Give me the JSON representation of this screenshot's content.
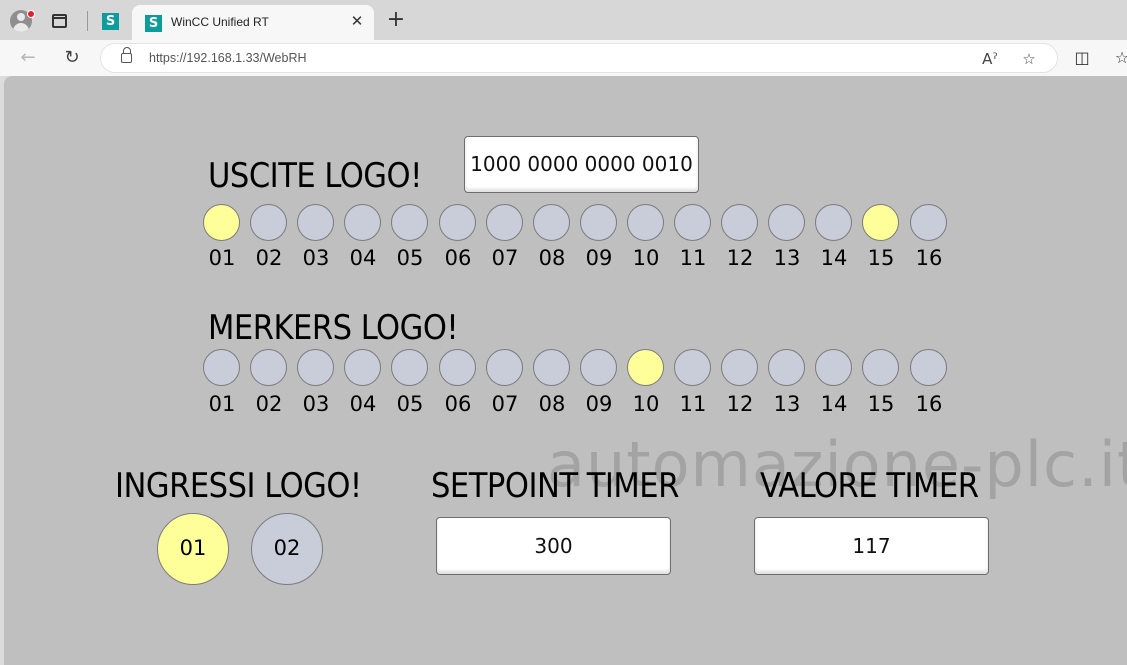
{
  "browser": {
    "tab_title": "WinCC Unified RT",
    "tab_logo": "S",
    "url": "https://192.168.1.33/WebRH",
    "icons": [
      "profile-icon",
      "tab-actions-icon",
      "back-icon",
      "reload-icon",
      "lock-icon",
      "read-aloud-icon",
      "favorite-star-icon",
      "split-screen-icon",
      "favorites-icon",
      "close-icon",
      "new-tab-icon"
    ]
  },
  "hmi": {
    "uscite": {
      "title": "USCITE LOGO!",
      "binary": "1000 0000 0000 0010",
      "leds": [
        {
          "num": "01",
          "on": true
        },
        {
          "num": "02",
          "on": false
        },
        {
          "num": "03",
          "on": false
        },
        {
          "num": "04",
          "on": false
        },
        {
          "num": "05",
          "on": false
        },
        {
          "num": "06",
          "on": false
        },
        {
          "num": "07",
          "on": false
        },
        {
          "num": "08",
          "on": false
        },
        {
          "num": "09",
          "on": false
        },
        {
          "num": "10",
          "on": false
        },
        {
          "num": "11",
          "on": false
        },
        {
          "num": "12",
          "on": false
        },
        {
          "num": "13",
          "on": false
        },
        {
          "num": "14",
          "on": false
        },
        {
          "num": "15",
          "on": true
        },
        {
          "num": "16",
          "on": false
        }
      ]
    },
    "merkers": {
      "title": "MERKERS LOGO!",
      "leds": [
        {
          "num": "01",
          "on": false
        },
        {
          "num": "02",
          "on": false
        },
        {
          "num": "03",
          "on": false
        },
        {
          "num": "04",
          "on": false
        },
        {
          "num": "05",
          "on": false
        },
        {
          "num": "06",
          "on": false
        },
        {
          "num": "07",
          "on": false
        },
        {
          "num": "08",
          "on": false
        },
        {
          "num": "09",
          "on": false
        },
        {
          "num": "10",
          "on": true
        },
        {
          "num": "11",
          "on": false
        },
        {
          "num": "12",
          "on": false
        },
        {
          "num": "13",
          "on": false
        },
        {
          "num": "14",
          "on": false
        },
        {
          "num": "15",
          "on": false
        },
        {
          "num": "16",
          "on": false
        }
      ]
    },
    "ingressi": {
      "title": "INGRESSI LOGO!",
      "leds": [
        {
          "num": "01",
          "on": true
        },
        {
          "num": "02",
          "on": false
        }
      ]
    },
    "setpoint": {
      "title": "SETPOINT TIMER",
      "value": "300"
    },
    "valore": {
      "title": "VALORE TIMER",
      "value": "117"
    },
    "watermark": "automazione-plc.it",
    "colors": {
      "led_on": "#ffff99",
      "led_off": "#c9ccd9",
      "background": "#bfbfbf"
    }
  }
}
